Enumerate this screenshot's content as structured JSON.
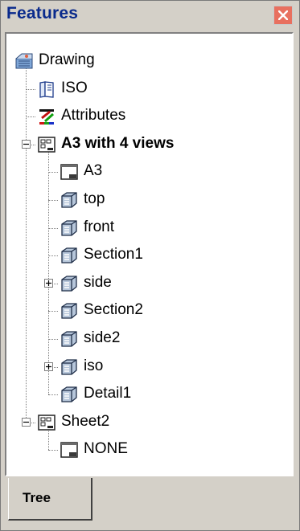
{
  "panel": {
    "title": "Features",
    "close_icon": "close-icon"
  },
  "tree": {
    "items": [
      {
        "label": "Drawing",
        "icon": "drawing-icon",
        "level": 0,
        "bold": false,
        "expander": null
      },
      {
        "label": "ISO",
        "icon": "book-icon",
        "level": 1,
        "bold": false,
        "expander": null
      },
      {
        "label": "Attributes",
        "icon": "attributes-icon",
        "level": 1,
        "bold": false,
        "expander": null
      },
      {
        "label": "A3 with 4 views",
        "icon": "sheet-icon",
        "level": 1,
        "bold": true,
        "expander": "collapse"
      },
      {
        "label": "A3",
        "icon": "format-icon",
        "level": 2,
        "bold": false,
        "expander": null
      },
      {
        "label": "top",
        "icon": "view-icon",
        "level": 2,
        "bold": false,
        "expander": null
      },
      {
        "label": "front",
        "icon": "view-icon",
        "level": 2,
        "bold": false,
        "expander": null
      },
      {
        "label": "Section1",
        "icon": "view-icon",
        "level": 2,
        "bold": false,
        "expander": null
      },
      {
        "label": "side",
        "icon": "view-icon",
        "level": 2,
        "bold": false,
        "expander": "expand"
      },
      {
        "label": "Section2",
        "icon": "view-icon",
        "level": 2,
        "bold": false,
        "expander": null
      },
      {
        "label": "side2",
        "icon": "view-icon",
        "level": 2,
        "bold": false,
        "expander": null
      },
      {
        "label": "iso",
        "icon": "view-icon",
        "level": 2,
        "bold": false,
        "expander": "expand"
      },
      {
        "label": "Detail1",
        "icon": "view-icon",
        "level": 2,
        "bold": false,
        "expander": null
      },
      {
        "label": "Sheet2",
        "icon": "sheet-icon",
        "level": 1,
        "bold": false,
        "expander": "collapse"
      },
      {
        "label": "NONE",
        "icon": "format-icon",
        "level": 2,
        "bold": false,
        "expander": null
      }
    ]
  },
  "tabs": [
    {
      "label": "Tree",
      "active": true
    }
  ]
}
